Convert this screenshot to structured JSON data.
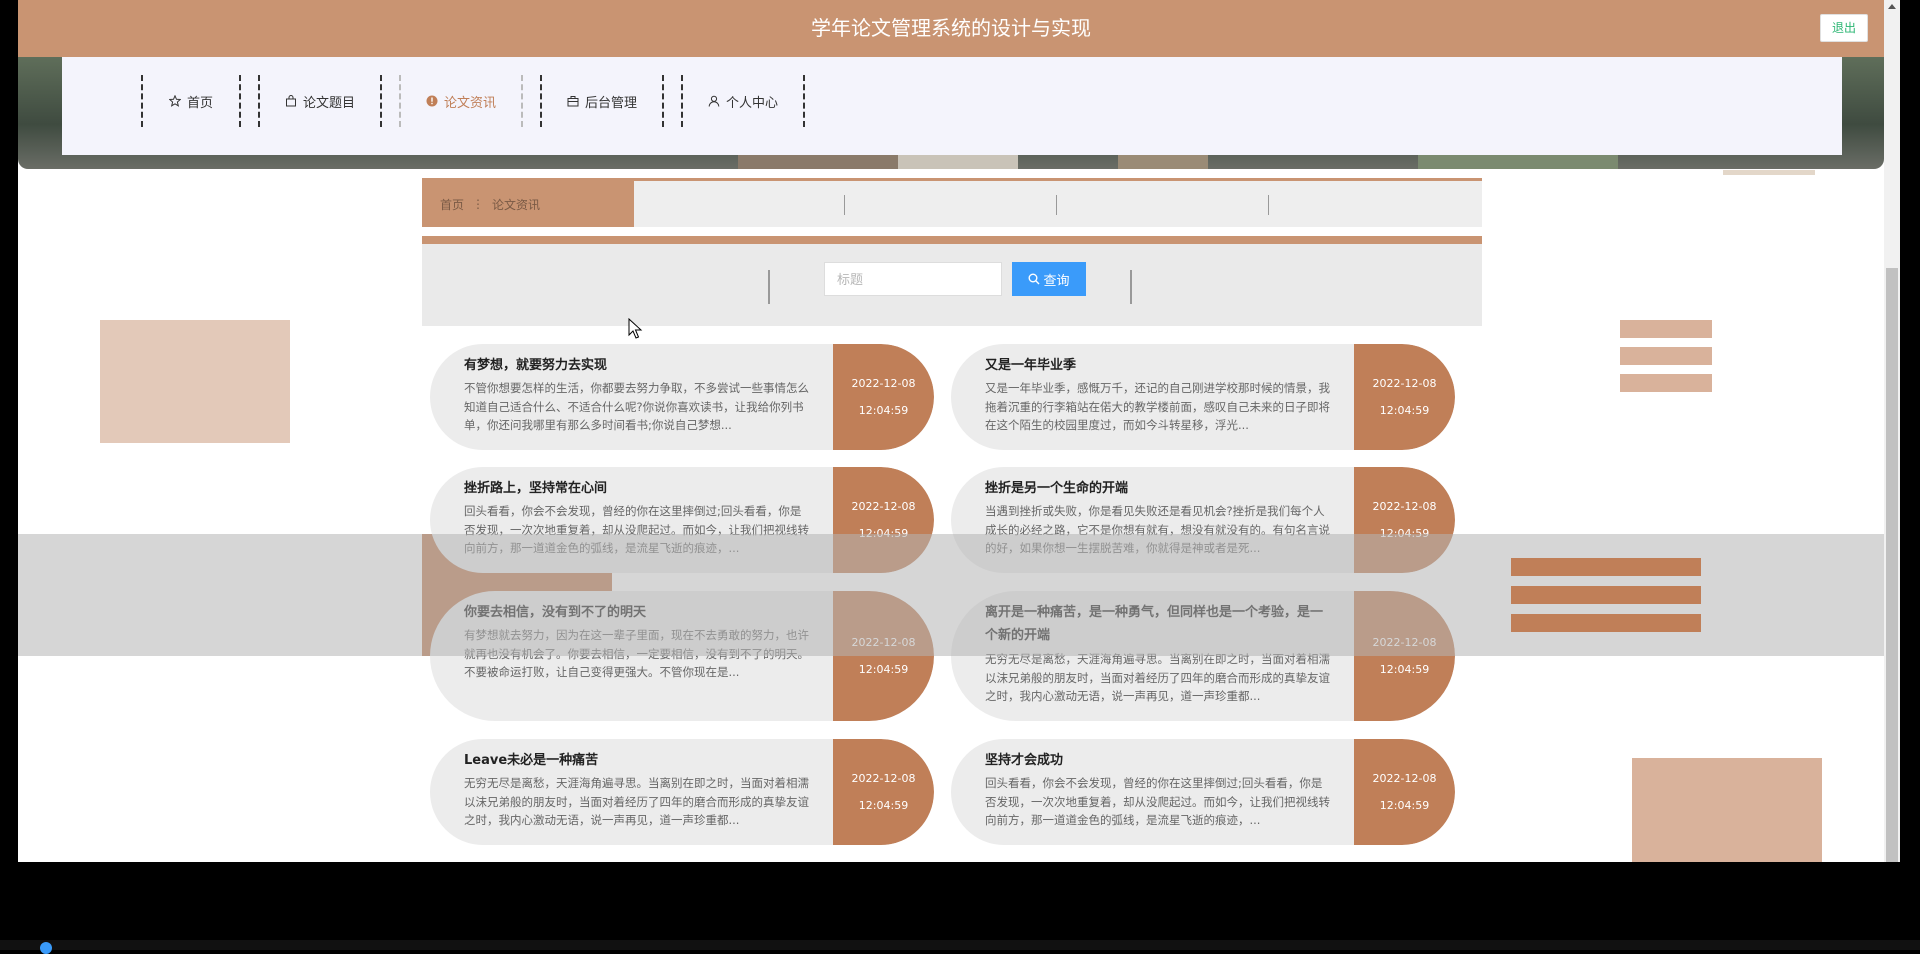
{
  "header": {
    "title": "学年论文管理系统的设计与实现",
    "logout_label": "退出"
  },
  "nav": {
    "items": [
      {
        "label": "首页",
        "icon": "star-icon"
      },
      {
        "label": "论文题目",
        "icon": "bag-icon"
      },
      {
        "label": "论文资讯",
        "icon": "info-circle-icon",
        "active": true
      },
      {
        "label": "后台管理",
        "icon": "briefcase-icon"
      },
      {
        "label": "个人中心",
        "icon": "user-icon"
      }
    ]
  },
  "breadcrumb": {
    "home": "首页",
    "separator": "⋮",
    "current": "论文资讯"
  },
  "search": {
    "placeholder": "标题",
    "value": "",
    "button_label": "查询"
  },
  "articles": [
    {
      "title": "有梦想，就要努力去实现",
      "excerpt": "不管你想要怎样的生活，你都要去努力争取，不多尝试一些事情怎么知道自己适合什么、不适合什么呢?你说你喜欢读书，让我给你列书单，你还问我哪里有那么多时间看书;你说自己梦想...",
      "date": "2022-12-08",
      "time": "12:04:59"
    },
    {
      "title": "又是一年毕业季",
      "excerpt": "又是一年毕业季，感慨万千，还记的自己刚进学校那时候的情景，我拖着沉重的行李箱站在偌大的教学楼前面，感叹自己未来的日子即将在这个陌生的校园里度过，而如今斗转星移，浮光...",
      "date": "2022-12-08",
      "time": "12:04:59"
    },
    {
      "title": "挫折路上，坚持常在心间",
      "excerpt": "回头看看，你会不会发现，曾经的你在这里摔倒过;回头看看，你是否发现，一次次地重复着，却从没爬起过。而如今，让我们把视线转向前方，那一道道金色的弧线，是流星飞逝的痕迹，...",
      "date": "2022-12-08",
      "time": "12:04:59"
    },
    {
      "title": "挫折是另一个生命的开端",
      "excerpt": "当遇到挫折或失败，你是看见失败还是看见机会?挫折是我们每个人成长的必经之路，它不是你想有就有，想没有就没有的。有句名言说的好，如果你想一生摆脱苦难，你就得是神或者是死...",
      "date": "2022-12-08",
      "time": "12:04:59"
    },
    {
      "title": "你要去相信，没有到不了的明天",
      "excerpt": "有梦想就去努力，因为在这一辈子里面，现在不去勇敢的努力，也许就再也没有机会了。你要去相信，一定要相信，没有到不了的明天。不要被命运打败，让自己变得更强大。不管你现在是...",
      "date": "2022-12-08",
      "time": "12:04:59"
    },
    {
      "title": "离开是一种痛苦，是一种勇气，但同样也是一个考验，是一个新的开端",
      "excerpt": "无穷无尽是离愁，天涯海角遍寻思。当离别在即之时，当面对着相濡以沫兄弟般的朋友时，当面对着经历了四年的磨合而形成的真挚友谊之时，我内心激动无语，说一声再见，道一声珍重都...",
      "date": "2022-12-08",
      "time": "12:04:59"
    },
    {
      "title": "Leave未必是一种痛苦",
      "excerpt": "无穷无尽是离愁，天涯海角遍寻思。当离别在即之时，当面对着相濡以沫兄弟般的朋友时，当面对着经历了四年的磨合而形成的真挚友谊之时，我内心激动无语，说一声再见，道一声珍重都...",
      "date": "2022-12-08",
      "time": "12:04:59"
    },
    {
      "title": "坚持才会成功",
      "excerpt": "回头看看，你会不会发现，曾经的你在这里摔倒过;回头看看，你是否发现，一次次地重复着，却从没爬起过。而如今，让我们把视线转向前方，那一道道金色的弧线，是流星飞逝的痕迹，...",
      "date": "2022-12-08",
      "time": "12:04:59"
    }
  ],
  "colors": {
    "brand": "#c99472",
    "accent_dark": "#c07f58",
    "search_button": "#3a9bfa",
    "logout_text": "#2bb673"
  }
}
